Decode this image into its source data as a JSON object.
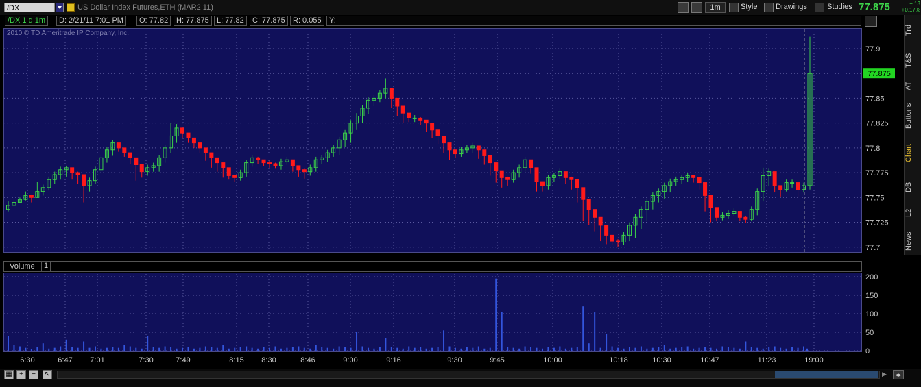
{
  "toolbar": {
    "symbol": "/DX",
    "description": "US Dollar Index Futures,ETH (MAR2 11)",
    "timeframe_button": "1m",
    "style_label": "Style",
    "drawings_label": "Drawings",
    "studies_label": "Studies",
    "last_price": "77.875",
    "net_change": "+.13",
    "pct_change": "+0.17%"
  },
  "info_bar": {
    "symbol_period": "/DX 1 d 1m",
    "date": "D: 2/21/11 7:01 PM",
    "open": "O: 77.82",
    "high": "H: 77.875",
    "low": "L: 77.82",
    "close": "C: 77.875",
    "range": "R: 0.055",
    "y": "Y:"
  },
  "copyright": "2010 © TD Ameritrade IP Company, Inc.",
  "volume_header": {
    "label": "Volume",
    "count": "1"
  },
  "side_tabs": [
    "Trd",
    "T&S",
    "AT",
    "Buttons",
    "Chart",
    "DB",
    "L2",
    "News"
  ],
  "colors": {
    "up": "#3bd04a",
    "down": "#ff1a1a",
    "panel_bg": "#10105a",
    "grid": "#5a5aa0",
    "volume": "#3355dd",
    "last_price_tag": "#22d522"
  },
  "chart_data": [
    {
      "type": "candlestick",
      "title": "/DX 1 d 1m",
      "ylim": [
        77.695,
        77.92
      ],
      "y_ticks": [
        "77.9",
        "77.875",
        "77.85",
        "77.825",
        "77.8",
        "77.775",
        "77.75",
        "77.725",
        "77.7"
      ],
      "x_ticks": [
        "6:30",
        "6:47",
        "7:01",
        "7:30",
        "7:49",
        "8:15",
        "8:30",
        "8:46",
        "9:00",
        "9:16",
        "9:30",
        "9:45",
        "10:00",
        "10:18",
        "10:30",
        "10:47",
        "11:23",
        "19:00"
      ],
      "last_price_label": "77.875",
      "grid": true,
      "close": [
        77.742,
        77.745,
        77.748,
        77.752,
        77.75,
        77.756,
        77.76,
        77.768,
        77.773,
        77.778,
        77.78,
        77.775,
        77.773,
        77.762,
        77.767,
        77.778,
        77.79,
        77.798,
        77.805,
        77.8,
        77.795,
        77.79,
        77.783,
        77.776,
        77.78,
        77.782,
        77.79,
        77.8,
        77.812,
        77.82,
        77.815,
        77.81,
        77.805,
        77.8,
        77.795,
        77.79,
        77.785,
        77.78,
        77.772,
        77.77,
        77.775,
        77.785,
        77.79,
        77.788,
        77.785,
        77.784,
        77.782,
        77.786,
        77.788,
        77.782,
        77.778,
        77.776,
        77.78,
        77.788,
        77.79,
        77.795,
        77.8,
        77.808,
        77.815,
        77.825,
        77.832,
        77.84,
        77.848,
        77.85,
        77.855,
        77.86,
        77.85,
        77.842,
        77.835,
        77.83,
        77.83,
        77.828,
        77.825,
        77.818,
        77.812,
        77.805,
        77.798,
        77.794,
        77.798,
        77.8,
        77.802,
        77.798,
        77.792,
        77.785,
        77.777,
        77.77,
        77.768,
        77.775,
        77.78,
        77.788,
        77.78,
        77.766,
        77.762,
        77.77,
        77.772,
        77.776,
        77.77,
        77.768,
        77.76,
        77.748,
        77.738,
        77.73,
        77.722,
        77.712,
        77.706,
        77.705,
        77.712,
        77.722,
        77.73,
        77.738,
        77.746,
        77.752,
        77.756,
        77.762,
        77.766,
        77.768,
        77.77,
        77.772,
        77.77,
        77.765,
        77.752,
        77.74,
        77.73,
        77.732,
        77.734,
        77.736,
        77.73,
        77.728,
        77.738,
        77.756,
        77.772,
        77.776,
        77.762,
        77.758,
        77.765,
        77.765,
        77.758,
        77.762,
        77.875
      ],
      "high": [
        77.746,
        77.748,
        77.75,
        77.756,
        77.753,
        77.766,
        77.763,
        77.771,
        77.776,
        77.781,
        77.782,
        77.779,
        77.776,
        77.767,
        77.77,
        77.781,
        77.793,
        77.801,
        77.808,
        77.803,
        77.799,
        77.794,
        77.787,
        77.779,
        77.783,
        77.785,
        77.793,
        77.803,
        77.825,
        77.824,
        77.818,
        77.813,
        77.808,
        77.803,
        77.798,
        77.793,
        77.788,
        77.783,
        77.776,
        77.773,
        77.778,
        77.788,
        77.793,
        77.791,
        77.788,
        77.787,
        77.785,
        77.789,
        77.791,
        77.785,
        77.781,
        77.779,
        77.783,
        77.791,
        77.793,
        77.798,
        77.803,
        77.811,
        77.818,
        77.828,
        77.835,
        77.843,
        77.851,
        77.853,
        77.858,
        77.87,
        77.86,
        77.846,
        77.838,
        77.833,
        77.833,
        77.831,
        77.828,
        77.821,
        77.815,
        77.808,
        77.801,
        77.797,
        77.801,
        77.803,
        77.805,
        77.801,
        77.795,
        77.788,
        77.78,
        77.773,
        77.771,
        77.778,
        77.783,
        77.791,
        77.784,
        77.77,
        77.766,
        77.773,
        77.775,
        77.779,
        77.773,
        77.771,
        77.763,
        77.752,
        77.742,
        77.734,
        77.726,
        77.716,
        77.71,
        77.708,
        77.715,
        77.725,
        77.733,
        77.741,
        77.749,
        77.755,
        77.759,
        77.765,
        77.769,
        77.771,
        77.773,
        77.775,
        77.773,
        77.768,
        77.756,
        77.744,
        77.734,
        77.735,
        77.737,
        77.739,
        77.733,
        77.731,
        77.741,
        77.759,
        77.78,
        77.779,
        77.766,
        77.762,
        77.768,
        77.768,
        77.762,
        77.765,
        77.912
      ],
      "low": [
        77.736,
        77.741,
        77.744,
        77.747,
        77.745,
        77.75,
        77.752,
        77.757,
        77.764,
        77.768,
        77.771,
        77.768,
        77.764,
        77.745,
        77.756,
        77.764,
        77.774,
        77.785,
        77.792,
        77.796,
        77.791,
        77.784,
        77.767,
        77.77,
        77.772,
        77.776,
        77.776,
        77.785,
        77.795,
        77.805,
        77.81,
        77.805,
        77.8,
        77.795,
        77.787,
        77.78,
        77.776,
        77.77,
        77.768,
        77.766,
        77.767,
        77.771,
        77.781,
        77.784,
        77.782,
        77.78,
        77.779,
        77.778,
        77.783,
        77.776,
        77.771,
        77.769,
        77.772,
        77.776,
        77.784,
        77.786,
        77.791,
        77.793,
        77.801,
        77.805,
        77.818,
        77.825,
        77.834,
        77.842,
        77.846,
        77.85,
        77.84,
        77.832,
        77.825,
        77.826,
        77.826,
        77.823,
        77.816,
        77.81,
        77.804,
        77.795,
        77.788,
        77.79,
        77.791,
        77.795,
        77.795,
        77.789,
        77.783,
        77.772,
        77.765,
        77.76,
        77.762,
        77.765,
        77.77,
        77.776,
        77.774,
        77.756,
        77.756,
        77.758,
        77.766,
        77.769,
        77.764,
        77.758,
        77.745,
        77.726,
        77.722,
        77.716,
        77.706,
        77.703,
        77.702,
        77.7,
        77.702,
        77.706,
        77.709,
        77.718,
        77.726,
        77.738,
        77.745,
        77.749,
        77.755,
        77.762,
        77.764,
        77.766,
        77.765,
        77.758,
        77.736,
        77.725,
        77.726,
        77.727,
        77.729,
        77.731,
        77.726,
        77.724,
        77.726,
        77.732,
        77.746,
        77.762,
        77.755,
        77.751,
        77.756,
        77.76,
        77.75,
        77.755,
        77.758
      ],
      "volume": [
        40,
        15,
        12,
        8,
        5,
        10,
        20,
        6,
        8,
        12,
        30,
        10,
        8,
        25,
        8,
        12,
        6,
        8,
        10,
        8,
        15,
        12,
        8,
        6,
        40,
        10,
        8,
        12,
        10,
        6,
        8,
        10,
        6,
        8,
        12,
        10,
        8,
        15,
        6,
        8,
        10,
        12,
        8,
        6,
        10,
        8,
        12,
        6,
        8,
        10,
        12,
        8,
        6,
        15,
        10,
        8,
        6,
        12,
        10,
        8,
        50,
        12,
        8,
        6,
        10,
        35,
        10,
        8,
        6,
        12,
        8,
        10,
        6,
        8,
        10,
        55,
        12,
        8,
        6,
        10,
        8,
        12,
        6,
        8,
        195,
        105,
        10,
        8,
        6,
        12,
        10,
        8,
        6,
        10,
        8,
        12,
        6,
        8,
        10,
        120,
        20,
        105,
        8,
        45,
        12,
        8,
        6,
        10,
        8,
        12,
        6,
        8,
        10,
        15,
        6,
        8,
        10,
        12,
        6,
        8,
        10,
        8,
        6,
        12,
        10,
        8,
        6,
        25,
        10,
        8,
        6,
        10,
        12,
        8,
        6,
        10,
        8,
        12,
        6,
        8,
        60
      ]
    },
    {
      "type": "bar",
      "title": "Volume",
      "ylim": [
        0,
        200
      ],
      "y_ticks": [
        "200",
        "150",
        "100",
        "50",
        "0"
      ]
    }
  ]
}
